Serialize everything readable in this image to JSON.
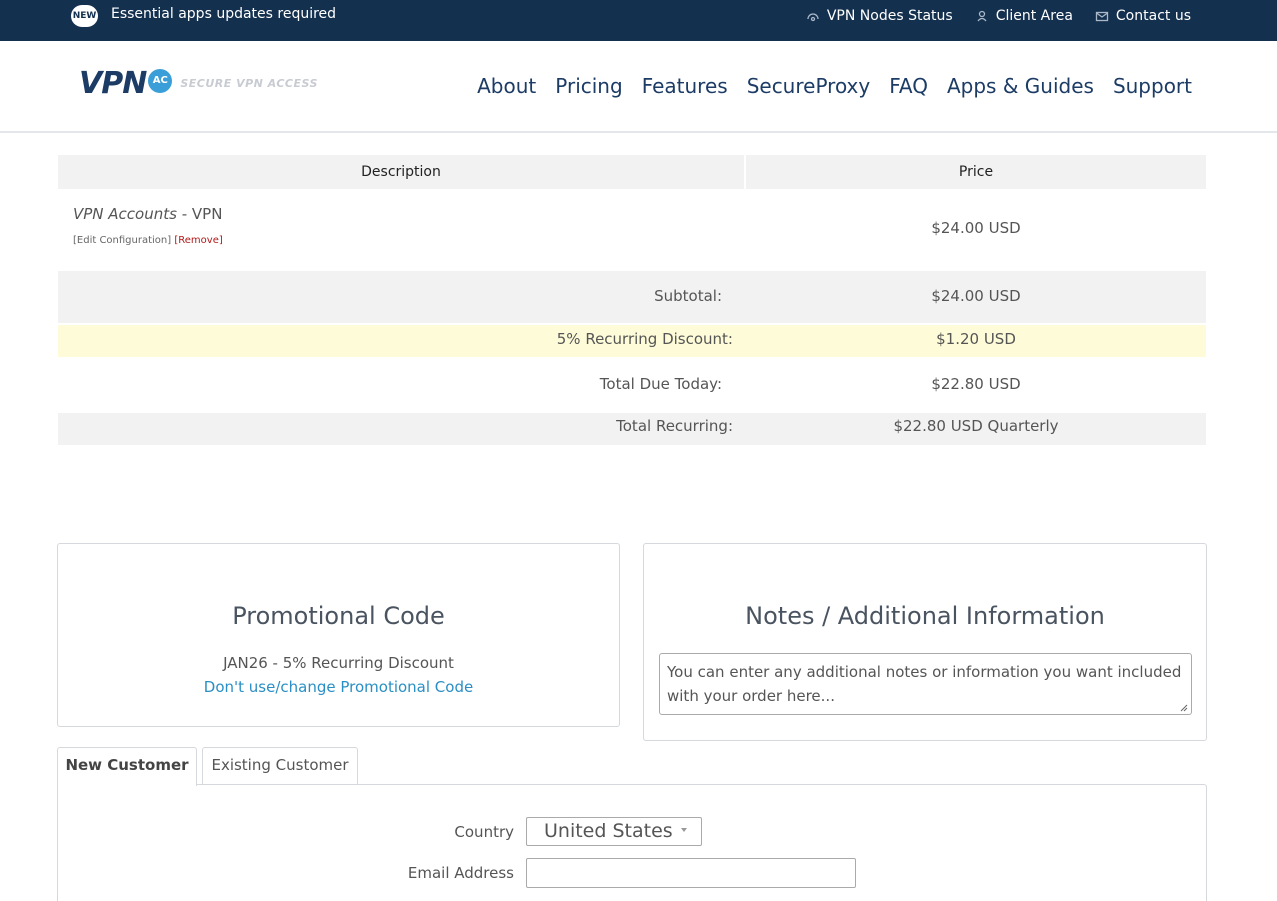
{
  "topbar": {
    "badge": "NEW",
    "message": "Essential apps updates required",
    "links": [
      {
        "label": "VPN Nodes Status",
        "icon": "network-icon"
      },
      {
        "label": "Client Area",
        "icon": "user-icon"
      },
      {
        "label": "Contact us",
        "icon": "envelope-icon"
      }
    ]
  },
  "header": {
    "logo_text": "VPN",
    "logo_badge": "AC",
    "logo_tagline": "SECURE VPN ACCESS",
    "nav": [
      "About",
      "Pricing",
      "Features",
      "SecureProxy",
      "FAQ",
      "Apps & Guides",
      "Support"
    ]
  },
  "order": {
    "columns": {
      "description": "Description",
      "price": "Price"
    },
    "item": {
      "product_group": "VPN Accounts",
      "product_name": " - VPN",
      "edit_label": "[Edit Configuration]",
      "remove_label": "[Remove]",
      "price": "$24.00 USD"
    },
    "subtotal": {
      "label": "Subtotal:",
      "value": "$24.00 USD"
    },
    "discount": {
      "label": "5% Recurring Discount:",
      "value": "$1.20 USD"
    },
    "due_today": {
      "label": "Total Due Today:",
      "value": "$22.80 USD"
    },
    "recurring": {
      "label": "Total Recurring:",
      "value": "$22.80 USD Quarterly"
    }
  },
  "promo": {
    "title": "Promotional Code",
    "applied": "JAN26 - 5% Recurring Discount",
    "change_link": "Don't use/change Promotional Code"
  },
  "notes": {
    "title": "Notes / Additional Information",
    "placeholder": "You can enter any additional notes or information you want included with your order here..."
  },
  "customer": {
    "tabs": [
      "New Customer",
      "Existing Customer"
    ],
    "country_label": "Country",
    "country_value": "United States",
    "email_label": "Email Address",
    "email_value": ""
  },
  "colors": {
    "topbar": "#14304f",
    "brand": "#1c3c66",
    "link": "#2a8fc4",
    "discount_row": "#fefcd8",
    "remove": "#b01818"
  }
}
